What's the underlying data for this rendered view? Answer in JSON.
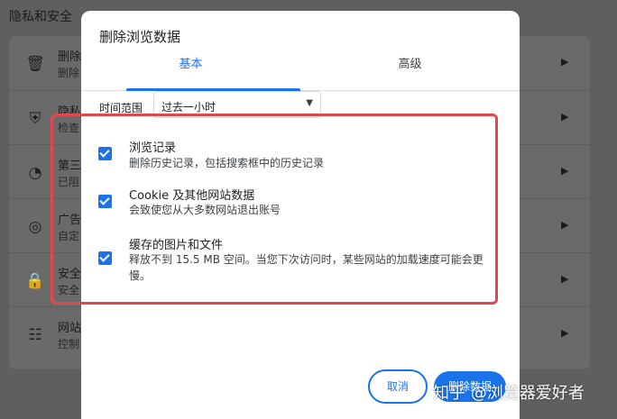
{
  "background": {
    "section_title": "隐私和安全",
    "rows": [
      {
        "icon": "trash-icon",
        "glyph": "🗑",
        "title": "删除",
        "desc": "删除"
      },
      {
        "icon": "shield-icon",
        "glyph": "⛨",
        "title": "隐私",
        "desc": "检查"
      },
      {
        "icon": "cookie-icon",
        "glyph": "◔",
        "title": "第三",
        "desc": "已阻"
      },
      {
        "icon": "ads-icon",
        "glyph": "◎",
        "title": "广告",
        "desc": "自定"
      },
      {
        "icon": "lock-icon",
        "glyph": "🔒",
        "title": "安全",
        "desc": "安全"
      },
      {
        "icon": "site-settings-icon",
        "glyph": "☷",
        "title": "网站",
        "desc": "控制"
      }
    ]
  },
  "dialog": {
    "title": "删除浏览数据",
    "tabs": {
      "basic": "基本",
      "advanced": "高级"
    },
    "time_range": {
      "label": "时间范围",
      "selected": "过去一小时"
    },
    "options": [
      {
        "title": "浏览记录",
        "desc": "删除历史记录，包括搜索框中的历史记录",
        "checked": true
      },
      {
        "title": "Cookie 及其他网站数据",
        "desc": "会致使您从大多数网站退出账号",
        "checked": true
      },
      {
        "title": "缓存的图片和文件",
        "desc": "释放不到 15.5 MB 空间。当您下次访问时，某些网站的加载速度可能会更慢。",
        "checked": true
      }
    ],
    "buttons": {
      "cancel": "取消",
      "delete": "删除数据"
    }
  },
  "watermark": "知乎 @浏览器爱好者",
  "colors": {
    "accent": "#1a73e8",
    "highlight": "#e0484b"
  }
}
